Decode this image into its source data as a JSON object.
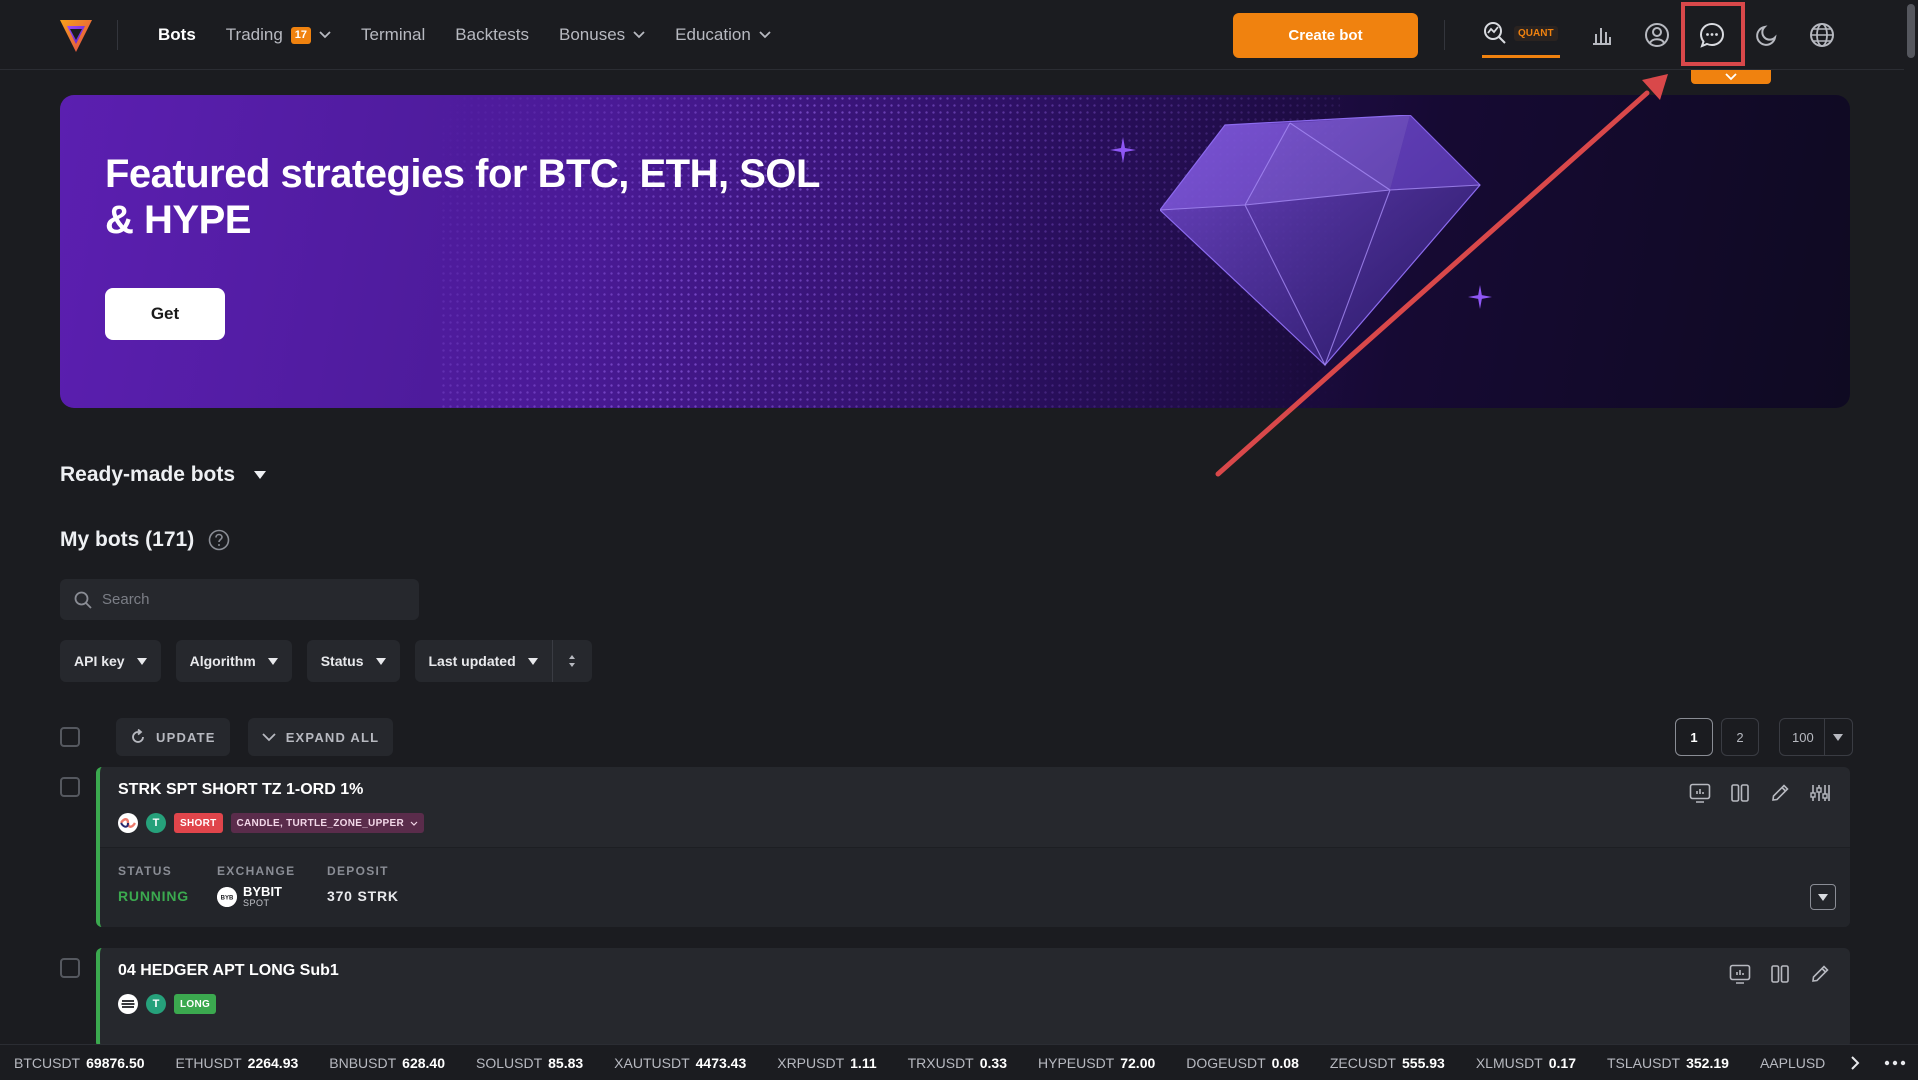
{
  "header": {
    "nav": [
      {
        "label": "Bots",
        "active": true
      },
      {
        "label": "Trading",
        "badge": "17",
        "dropdown": true
      },
      {
        "label": "Terminal"
      },
      {
        "label": "Backtests"
      },
      {
        "label": "Bonuses",
        "dropdown": true
      },
      {
        "label": "Education",
        "dropdown": true
      }
    ],
    "create_bot_label": "Create bot",
    "quant_label": "QUANT",
    "icons": [
      "quant-analytics-icon",
      "bar-chart-icon",
      "user-account-icon",
      "chat-support-icon",
      "moon-theme-icon",
      "globe-language-icon"
    ],
    "accent_color": "#f0820f",
    "highlight_color": "#d9484a"
  },
  "banner": {
    "title": "Featured strategies for BTC, ETH, SOL & HYPE",
    "cta_label": "Get"
  },
  "ready_made": {
    "label": "Ready-made bots"
  },
  "my_bots": {
    "label": "My bots (171)"
  },
  "search": {
    "placeholder": "Search"
  },
  "filters": {
    "api_key": "API key",
    "algorithm": "Algorithm",
    "status": "Status",
    "last_updated": "Last updated"
  },
  "toolbar": {
    "update_label": "UPDATE",
    "expand_label": "EXPAND ALL",
    "pages": [
      "1",
      "2"
    ],
    "per_page": "100"
  },
  "bots": [
    {
      "name": "STRK SPT SHORT TZ 1-ORD 1%",
      "direction": "SHORT",
      "algo": "CANDLE, TURTLE_ZONE_UPPER",
      "status_label": "STATUS",
      "status": "RUNNING",
      "exchange_label": "EXCHANGE",
      "exchange": "BYBIT",
      "exchange_sub": "SPOT",
      "deposit_label": "DEPOSIT",
      "deposit": "370 STRK"
    },
    {
      "name": "04 HEDGER APT LONG Sub1",
      "direction": "LONG"
    }
  ],
  "ticker": [
    {
      "sym": "BTCUSDT",
      "price": "69876.50"
    },
    {
      "sym": "ETHUSDT",
      "price": "2264.93"
    },
    {
      "sym": "BNBUSDT",
      "price": "628.40"
    },
    {
      "sym": "SOLUSDT",
      "price": "85.83"
    },
    {
      "sym": "XAUTUSDT",
      "price": "4473.43"
    },
    {
      "sym": "XRPUSDT",
      "price": "1.11"
    },
    {
      "sym": "TRXUSDT",
      "price": "0.33"
    },
    {
      "sym": "HYPEUSDT",
      "price": "72.00"
    },
    {
      "sym": "DOGEUSDT",
      "price": "0.08"
    },
    {
      "sym": "ZECUSDT",
      "price": "555.93"
    },
    {
      "sym": "XLMUSDT",
      "price": "0.17"
    },
    {
      "sym": "TSLAUSDT",
      "price": "352.19"
    },
    {
      "sym": "AAPLUSD",
      "price": ""
    }
  ]
}
